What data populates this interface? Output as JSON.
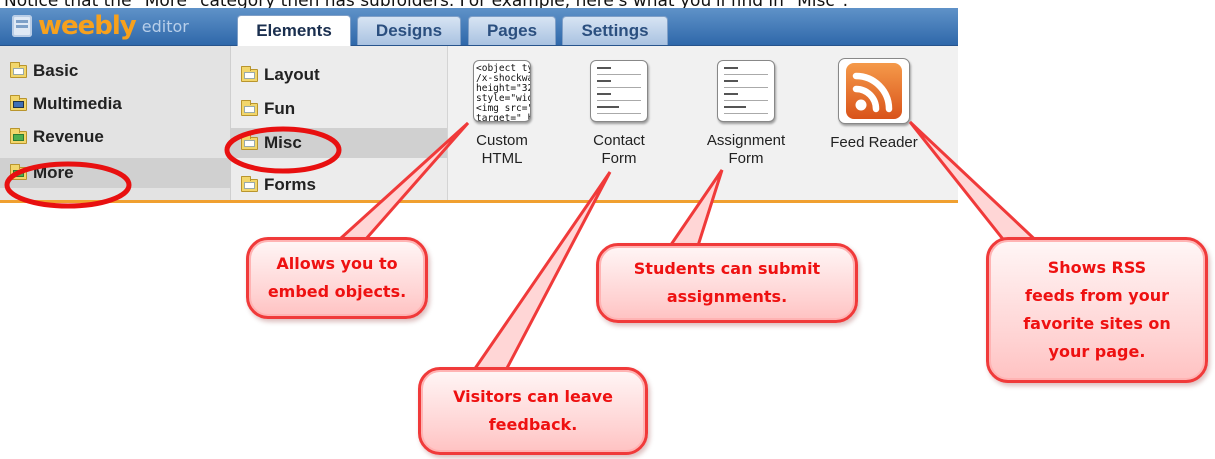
{
  "caption": "Notice that the \"More\" category then has subfolders. For example, here's what you'll find in \"Misc\":",
  "app": {
    "logo": "weebly",
    "logo_sub": "editor"
  },
  "tabs": [
    {
      "label": "Elements",
      "active": true
    },
    {
      "label": "Designs",
      "active": false
    },
    {
      "label": "Pages",
      "active": false
    },
    {
      "label": "Settings",
      "active": false
    }
  ],
  "categories": [
    {
      "label": "Basic",
      "icon": "folder-icon"
    },
    {
      "label": "Multimedia",
      "icon": "multimedia-folder-icon"
    },
    {
      "label": "Revenue",
      "icon": "revenue-folder-icon"
    },
    {
      "label": "More",
      "icon": "more-folder-icon",
      "selected": true
    }
  ],
  "subfolders": [
    {
      "label": "Layout"
    },
    {
      "label": "Fun"
    },
    {
      "label": "Misc",
      "selected": true
    },
    {
      "label": "Forms"
    }
  ],
  "elements": [
    {
      "label_line1": "Custom",
      "label_line2": "HTML",
      "preview": "<object ty\n/x-shockwa\nheight=\"32\nstyle=\"wid\n<img src=\"\ntarget=\"_b"
    },
    {
      "label_line1": "Contact",
      "label_line2": "Form"
    },
    {
      "label_line1": "Assignment",
      "label_line2": "Form"
    },
    {
      "label_line1": "Feed Reader",
      "label_line2": ""
    }
  ],
  "callouts": {
    "custom_html": "Allows you to\nembed objects.",
    "contact_form": "Visitors can leave\nfeedback.",
    "assignment_form": "Students can submit\nassignments.",
    "feed_reader": "Shows RSS\nfeeds from your\nfavorite sites on\nyour page."
  },
  "colors": {
    "highlight_ring": "#e81010",
    "callout_text": "#ee1111",
    "rss_orange": "#e8661c",
    "accent_bar": "#f0a030"
  }
}
